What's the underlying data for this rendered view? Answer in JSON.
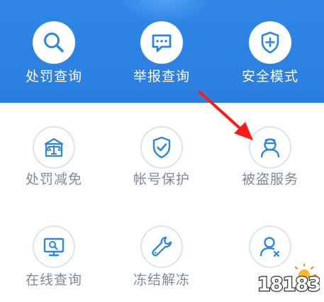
{
  "services": {
    "row1": [
      {
        "label": "处罚查询",
        "icon": "search-icon"
      },
      {
        "label": "举报查询",
        "icon": "chat-bubble-icon"
      },
      {
        "label": "安全模式",
        "icon": "shield-plus-icon"
      }
    ],
    "row2": [
      {
        "label": "处罚减免",
        "icon": "justice-scale-icon"
      },
      {
        "label": "帐号保护",
        "icon": "shield-check-icon"
      },
      {
        "label": "被盗服务",
        "icon": "thief-avatar-icon"
      }
    ],
    "row3": [
      {
        "label": "在线查询",
        "icon": "monitor-search-icon"
      },
      {
        "label": "冻结解冻",
        "icon": "wrench-icon"
      },
      {
        "label": "",
        "icon": "user-cancel-icon"
      }
    ]
  },
  "annotation": {
    "arrow_color": "#ff1a1a"
  },
  "watermark": {
    "text": "18183"
  },
  "colors": {
    "accent_blue": "#2f86e6",
    "icon_blue": "#2b86e0",
    "label_gray": "#7f8a96"
  }
}
